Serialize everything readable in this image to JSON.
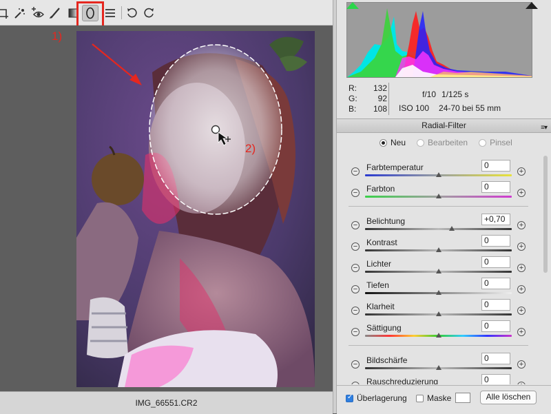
{
  "toolbar": {
    "items": [
      "crop-icon",
      "spot-removal-icon",
      "red-eye-icon",
      "adjustment-brush-icon",
      "graduated-filter-icon",
      "radial-filter-icon",
      "list-icon",
      "rotate-left-icon",
      "rotate-right-icon"
    ],
    "active": "radial-filter-icon"
  },
  "annotations": {
    "label1": "1)",
    "label2": "2)"
  },
  "status": {
    "filename": "IMG_66551.CR2"
  },
  "histogram": {
    "clip_shadow_color": "#2bd64a",
    "clip_highlight_color": "#222222"
  },
  "rgb": {
    "r_label": "R:",
    "r": "132",
    "g_label": "G:",
    "g": "92",
    "b_label": "B:",
    "b": "108"
  },
  "exif": {
    "aperture": "f/10",
    "shutter": "1/125 s",
    "iso": "ISO 100",
    "lens": "24-70 bei 55 mm"
  },
  "panel": {
    "title": "Radial-Filter",
    "menu_icon": "panel-menu-icon"
  },
  "modes": [
    {
      "label": "Neu",
      "selected": true
    },
    {
      "label": "Bearbeiten",
      "selected": false
    },
    {
      "label": "Pinsel",
      "selected": false
    }
  ],
  "sliders": [
    {
      "name": "Farbtemperatur",
      "value": "0",
      "position": 0.5,
      "track": "temp"
    },
    {
      "name": "Farbton",
      "value": "0",
      "position": 0.5,
      "track": "tint"
    },
    {
      "name": "Belichtung",
      "value": "+0,70",
      "position": 0.59,
      "track": "gray"
    },
    {
      "name": "Kontrast",
      "value": "0",
      "position": 0.5,
      "track": "gray"
    },
    {
      "name": "Lichter",
      "value": "0",
      "position": 0.5,
      "track": "gray"
    },
    {
      "name": "Tiefen",
      "value": "0",
      "position": 0.5,
      "track": "dark"
    },
    {
      "name": "Klarheit",
      "value": "0",
      "position": 0.5,
      "track": "gray"
    },
    {
      "name": "Sättigung",
      "value": "0",
      "position": 0.5,
      "track": "rainbow"
    },
    {
      "name": "Bildschärfe",
      "value": "0",
      "position": 0.5,
      "track": "gray"
    },
    {
      "name": "Rauschreduzierung",
      "value": "0",
      "position": 0.5,
      "track": "gray"
    }
  ],
  "footer": {
    "overlay_label": "Überlagerung",
    "overlay_checked": true,
    "mask_label": "Maske",
    "mask_checked": false,
    "mask_color": "#ffffff",
    "clear_all": "Alle löschen"
  },
  "colors": {
    "accent_red": "#e5271f",
    "panel_bg": "#e3e3e3"
  }
}
